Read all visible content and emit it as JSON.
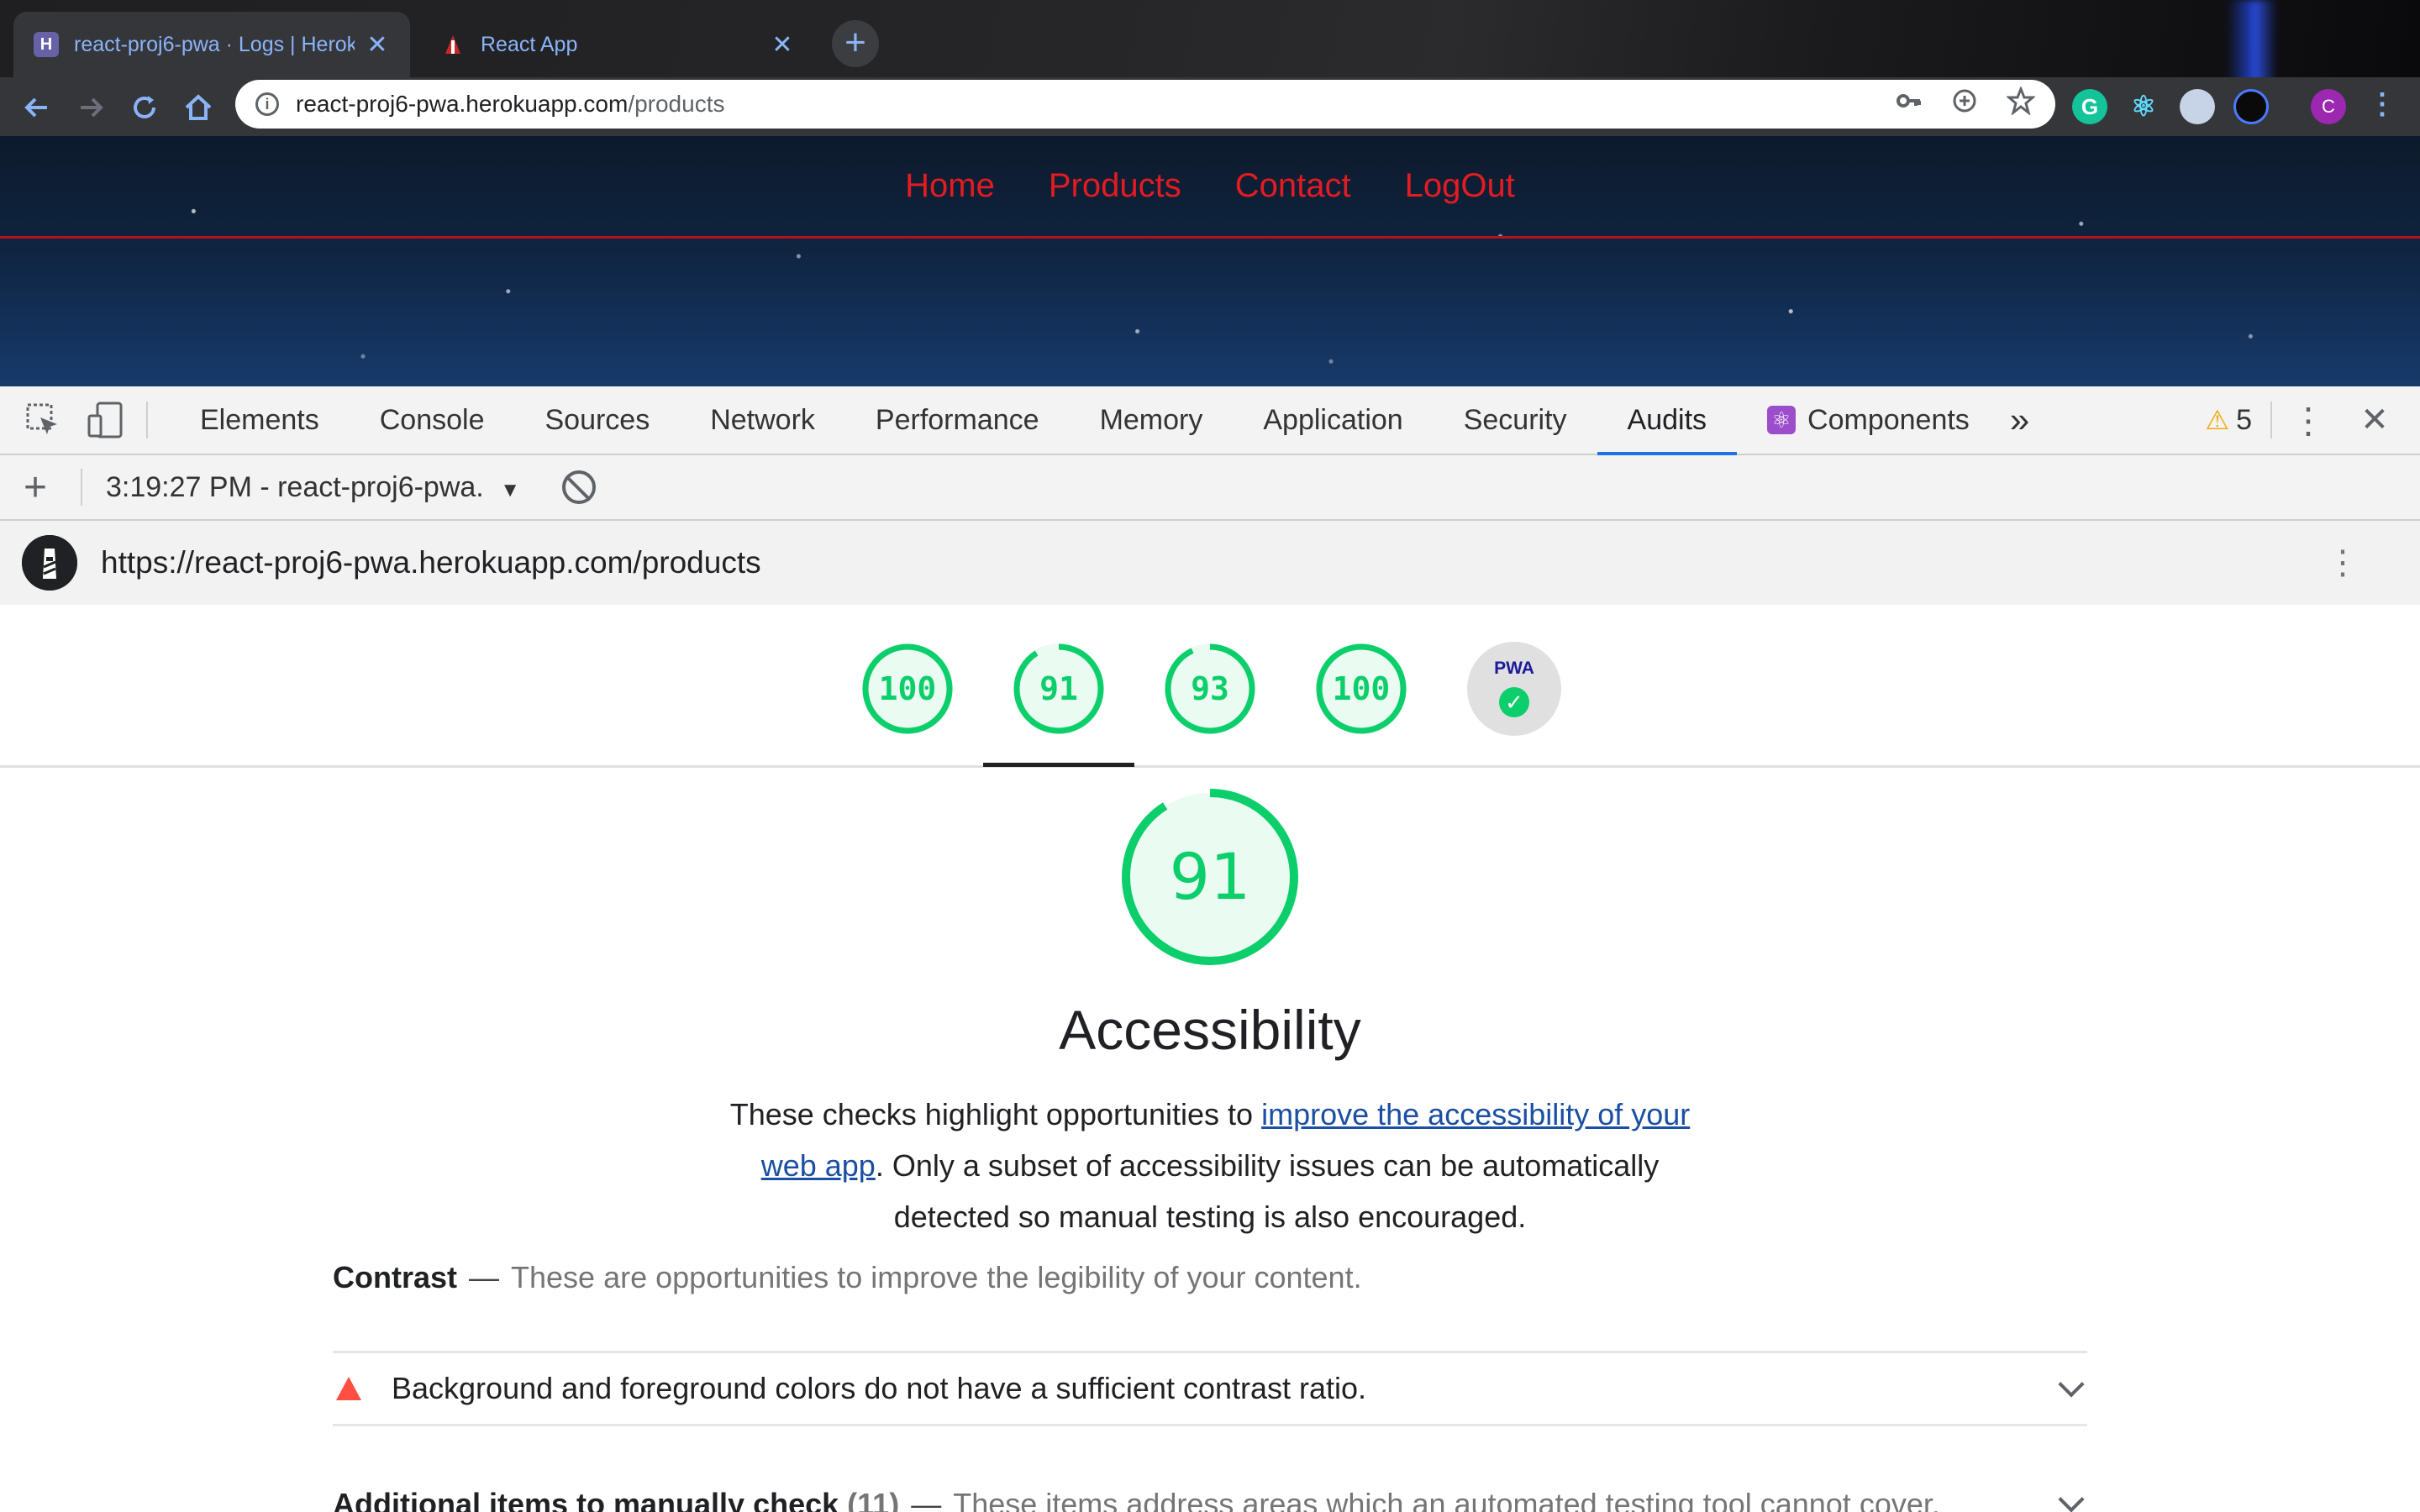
{
  "browser": {
    "tabs": [
      {
        "title": "react-proj6-pwa · Logs | Heroku",
        "active": true
      },
      {
        "title": "React App",
        "active": false
      }
    ],
    "close_glyph": "✕",
    "new_tab_glyph": "+",
    "url_host": "react-proj6-pwa.herokuapp.com",
    "url_path": "/products",
    "profile_initial": "C"
  },
  "site": {
    "nav": [
      "Home",
      "Products",
      "Contact",
      "LogOut"
    ]
  },
  "devtools": {
    "tabs": [
      "Elements",
      "Console",
      "Sources",
      "Network",
      "Performance",
      "Memory",
      "Application",
      "Security",
      "Audits",
      "Components"
    ],
    "active_tab": "Audits",
    "overflow_glyph": "»",
    "warning_count": "5",
    "report_label": "3:19:27 PM - react-proj6-pwa.",
    "dropdown_glyph": "▼",
    "add_glyph": "+"
  },
  "lighthouse": {
    "url": "https://react-proj6-pwa.herokuapp.com/products",
    "scores": [
      {
        "label": "100",
        "value": 100
      },
      {
        "label": "91",
        "value": 91
      },
      {
        "label": "93",
        "value": 93
      },
      {
        "label": "100",
        "value": 100
      }
    ],
    "pwa_label": "PWA",
    "pwa_check": "✓",
    "category": {
      "score": "91",
      "score_value": 91,
      "title": "Accessibility",
      "desc_before": "These checks highlight opportunities to ",
      "desc_link": "improve the accessibility of your web app",
      "desc_after": ". Only a subset of accessibility issues can be automatically detected so manual testing is also encouraged."
    },
    "groups": [
      {
        "title": "Contrast",
        "separator": "—",
        "description": "These are opportunities to improve the legibility of your content.",
        "audits": [
          "Background and foreground colors do not have a sufficient contrast ratio."
        ]
      },
      {
        "title": "Additional items to manually check",
        "count": "(11)",
        "separator": "—",
        "description": "These items address areas which an automated testing tool cannot cover."
      }
    ]
  },
  "colors": {
    "pass": "#0cce6b",
    "fail": "#ff4e42",
    "site_nav": "#e31b23",
    "devtools_accent": "#1a73e8"
  }
}
